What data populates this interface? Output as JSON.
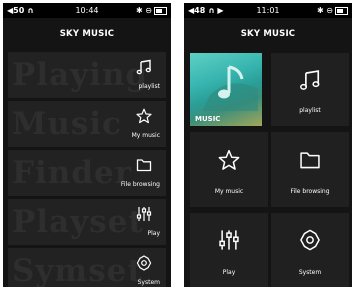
{
  "screen_list": {
    "status": {
      "left": "◀50 ∩",
      "time": "10:44",
      "right": "✱ ⊖"
    },
    "title": "SKY MUSIC",
    "rows": [
      {
        "ghost": "Playing",
        "label": "playlist",
        "icon": "music-note-icon"
      },
      {
        "ghost": "Music",
        "label": "My music",
        "icon": "star-icon"
      },
      {
        "ghost": "Finder",
        "label": "File browsing",
        "icon": "folder-icon"
      },
      {
        "ghost": "Playset",
        "label": "Play",
        "icon": "equalizer-icon"
      },
      {
        "ghost": "Symset",
        "label": "System",
        "icon": "gear-icon"
      }
    ]
  },
  "screen_grid": {
    "status": {
      "left": "◀48 ∩ ▶",
      "time": "11:01",
      "right": "✱ ⊖"
    },
    "title": "SKY MUSIC",
    "cover_label": "MUSIC",
    "tiles": [
      {
        "label": "playlist",
        "icon": "music-note-icon"
      },
      {
        "label": "My music",
        "icon": "star-icon"
      },
      {
        "label": "File browsing",
        "icon": "folder-icon"
      },
      {
        "label": "Play",
        "icon": "equalizer-icon"
      },
      {
        "label": "System",
        "icon": "gear-icon"
      }
    ]
  }
}
